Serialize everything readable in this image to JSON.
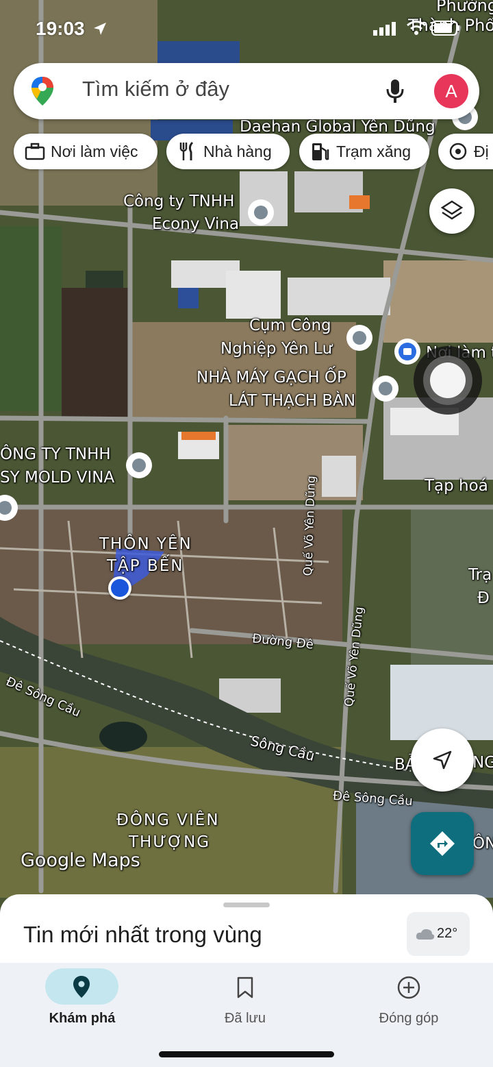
{
  "status": {
    "time": "19:03"
  },
  "search": {
    "placeholder": "Tìm kiếm ở đây",
    "avatar_letter": "A"
  },
  "chips": [
    {
      "label": "Nơi làm việc",
      "icon": "briefcase-icon"
    },
    {
      "label": "Nhà hàng",
      "icon": "fork-knife-icon"
    },
    {
      "label": "Trạm xăng",
      "icon": "gas-pump-icon"
    },
    {
      "label": "Đị",
      "icon": "landmark-icon"
    }
  ],
  "map": {
    "labels": [
      "Phường",
      "Thành Phố",
      "Daehan Global Yên Dũng",
      "Công ty TNHH",
      "Econy Vina",
      "Cụm Công",
      "Nghiệp Yên Lư",
      "Nơi làm t",
      "NHÀ MÁY GẠCH ỐP",
      "LÁT THẠCH BÀN",
      "ÔNG TY TNHH",
      "SY MOLD VINA",
      "Tạp hoá",
      "THÔN YÊN",
      "TẬP BẾN",
      "Trạ",
      "Đ",
      "Quế Võ Yên Dũng",
      "Đường Đê",
      "Đê Sông Cầu",
      "Sông Cầu",
      "Quế Võ Yên Dũng",
      "Đê Sông Cầu",
      "BẢ",
      "NG",
      "ĐÔNG VIÊN",
      "THƯỢNG",
      "ÔN",
      "Google Maps"
    ]
  },
  "sheet": {
    "title": "Tin mới nhất trong vùng",
    "weather": "22°"
  },
  "nav": [
    {
      "label": "Khám phá",
      "icon": "location-pin-icon",
      "active": true
    },
    {
      "label": "Đã lưu",
      "icon": "bookmark-icon",
      "active": false
    },
    {
      "label": "Đóng góp",
      "icon": "plus-circle-icon",
      "active": false
    }
  ],
  "colors": {
    "accent": "#0e6e7e",
    "nav_active_pill": "#c4e7ef",
    "avatar": "#e8365a",
    "location_dot": "#1a56db"
  }
}
